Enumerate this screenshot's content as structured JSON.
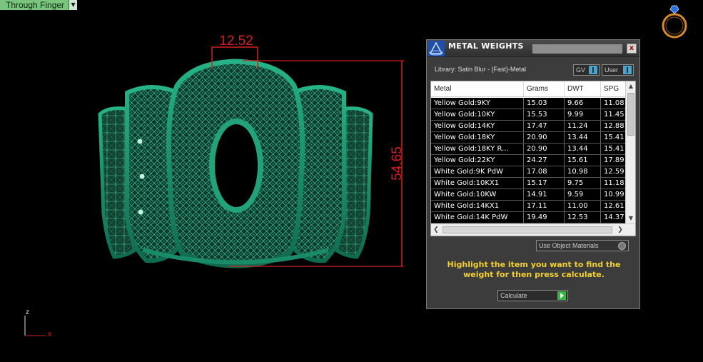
{
  "viewport": {
    "view_mode_label": "Through Finger",
    "dim_width": "12.52",
    "dim_height": "54.65",
    "axis_z": "z",
    "axis_x": "x",
    "accent_dimension": "#d11f1f",
    "model_color": "#1ea179"
  },
  "dialog": {
    "title": "METAL WEIGHTS",
    "close_label": "x",
    "library_label": "Library: Satin Blur - (Fast)-Metal",
    "gv_label": "GV",
    "user_label": "User",
    "columns": [
      "Metal",
      "Grams",
      "DWT",
      "SPG"
    ],
    "rows": [
      {
        "metal": "Yellow Gold:9KY",
        "grams": "15.03",
        "dwt": "9.66",
        "spg": "11.08"
      },
      {
        "metal": "Yellow Gold:10KY",
        "grams": "15.53",
        "dwt": "9.99",
        "spg": "11.45"
      },
      {
        "metal": "Yellow Gold:14KY",
        "grams": "17.47",
        "dwt": "11.24",
        "spg": "12.88"
      },
      {
        "metal": "Yellow Gold:18KY",
        "grams": "20.90",
        "dwt": "13.44",
        "spg": "15.41"
      },
      {
        "metal": "Yellow Gold:18KY R...",
        "grams": "20.90",
        "dwt": "13.44",
        "spg": "15.41"
      },
      {
        "metal": "Yellow Gold:22KY",
        "grams": "24.27",
        "dwt": "15.61",
        "spg": "17.89"
      },
      {
        "metal": "White Gold:9K PdW",
        "grams": "17.08",
        "dwt": "10.98",
        "spg": "12.59"
      },
      {
        "metal": "White Gold:10KX1",
        "grams": "15.17",
        "dwt": "9.75",
        "spg": "11.18"
      },
      {
        "metal": "White Gold:10KW",
        "grams": "14.91",
        "dwt": "9.59",
        "spg": "10.99"
      },
      {
        "metal": "White Gold:14KX1",
        "grams": "17.11",
        "dwt": "11.00",
        "spg": "12.61"
      },
      {
        "metal": "White Gold:14K PdW",
        "grams": "19.49",
        "dwt": "12.53",
        "spg": "14.37"
      }
    ],
    "use_object_materials": "Use Object Materials",
    "hint_text": "Highlight the item you want to find the weight for then press calculate.",
    "calculate_label": "Calculate",
    "hint_color": "#f3d032"
  }
}
